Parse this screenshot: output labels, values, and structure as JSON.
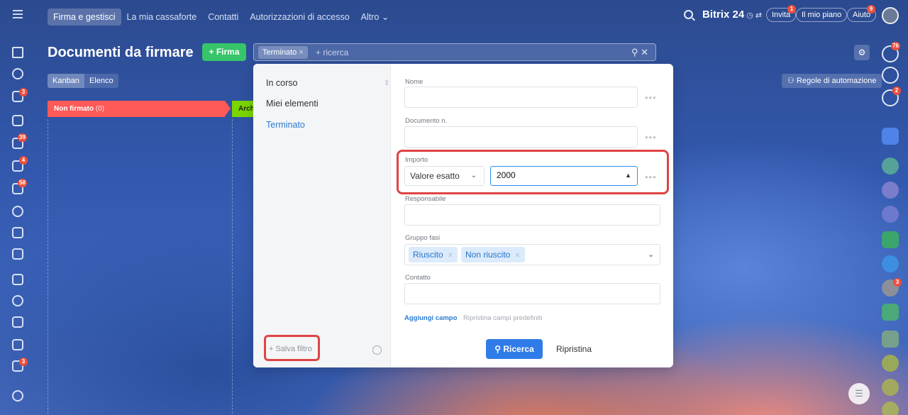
{
  "topnav": {
    "items": [
      "Firma e gestisci",
      "La mia cassaforte",
      "Contatti",
      "Autorizzazioni di accesso",
      "Altro"
    ],
    "active": "Firma e gestisci",
    "brand": "Bitrix",
    "brand_num": "24",
    "invite": "Invita",
    "invite_badge": "1",
    "plan": "Il mio piano",
    "help": "Aiuto",
    "help_badge": "9"
  },
  "left_badges": [
    "3",
    "39",
    "4",
    "58",
    "3"
  ],
  "right_badges": [
    "76",
    "2",
    "3"
  ],
  "page": {
    "title": "Documenti da firmare",
    "add_button": "+ Firma",
    "view_tabs": [
      "Kanban",
      "Elenco"
    ],
    "automation": "Regole di automazione"
  },
  "filter_bar": {
    "chip": "Terminato",
    "placeholder": "+ ricerca"
  },
  "kanban": {
    "stage1": "Non firmato",
    "stage1_count": "(0)",
    "stage2": "Archi"
  },
  "filter_panel": {
    "presets": [
      "In corso",
      "Miei elementi",
      "Terminato"
    ],
    "selected_preset": "Terminato",
    "save_filter": "+ Salva filtro",
    "fields": {
      "nome_label": "Nome",
      "documento_label": "Documento n.",
      "importo_label": "Importo",
      "importo_mode": "Valore esatto",
      "importo_value": "2000",
      "responsabile_label": "Responsabile",
      "gruppo_label": "Gruppo fasi",
      "gruppo_tags": [
        "Riuscito",
        "Non riuscito"
      ],
      "contatto_label": "Contatto"
    },
    "add_field": "Aggiungi campo",
    "reset_fields": "Ripristina campi predefiniti",
    "search_button": "Ricerca",
    "reset_button": "Ripristina"
  },
  "colors": {
    "accent": "#2f7ce8",
    "stage_red": "#ff5a58",
    "stage_green": "#7bd500",
    "highlight": "#e04444",
    "add_green": "#37c46b"
  }
}
